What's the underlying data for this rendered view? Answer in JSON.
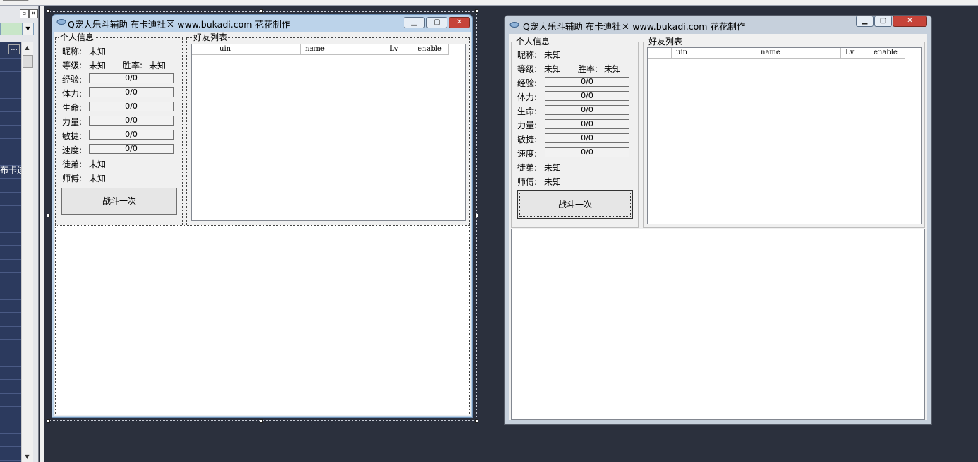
{
  "colors": {
    "desktop": "#2b303d",
    "accent_close": "#c6443a"
  },
  "left_panel": {
    "pin_icon": "pin-icon",
    "close_label": "×",
    "list_partial_text": "布卡迪社",
    "dots_label": "..."
  },
  "windows": [
    {
      "id": "designer",
      "title": "Q宠大乐斗辅助 布卡迪社区 www.bukadi.com 花花制作",
      "personal_group": "个人信息",
      "friends_group": "好友列表",
      "nickname_label": "昵称:",
      "nickname_value": "未知",
      "level_label": "等级:",
      "level_value": "未知",
      "winrate_label": "胜率:",
      "winrate_value": "未知",
      "stats": [
        {
          "label": "经验:",
          "value": "0/0"
        },
        {
          "label": "体力:",
          "value": "0/0"
        },
        {
          "label": "生命:",
          "value": "0/0"
        },
        {
          "label": "力量:",
          "value": "0/0"
        },
        {
          "label": "敏捷:",
          "value": "0/0"
        },
        {
          "label": "速度:",
          "value": "0/0"
        }
      ],
      "disciple_label": "徒弟:",
      "disciple_value": "未知",
      "master_label": "师傅:",
      "master_value": "未知",
      "fight_button": "战斗一次",
      "columns": [
        "",
        "uin",
        "name",
        "Lv",
        "enable"
      ]
    },
    {
      "id": "preview",
      "title": "Q宠大乐斗辅助 布卡迪社区 www.bukadi.com 花花制作",
      "personal_group": "个人信息",
      "friends_group": "好友列表",
      "nickname_label": "昵称:",
      "nickname_value": "未知",
      "level_label": "等级:",
      "level_value": "未知",
      "winrate_label": "胜率:",
      "winrate_value": "未知",
      "stats": [
        {
          "label": "经验:",
          "value": "0/0"
        },
        {
          "label": "体力:",
          "value": "0/0"
        },
        {
          "label": "生命:",
          "value": "0/0"
        },
        {
          "label": "力量:",
          "value": "0/0"
        },
        {
          "label": "敏捷:",
          "value": "0/0"
        },
        {
          "label": "速度:",
          "value": "0/0"
        }
      ],
      "disciple_label": "徒弟:",
      "disciple_value": "未知",
      "master_label": "师傅:",
      "master_value": "未知",
      "fight_button": "战斗一次",
      "columns": [
        "",
        "uin",
        "name",
        "Lv",
        "enable"
      ]
    }
  ]
}
